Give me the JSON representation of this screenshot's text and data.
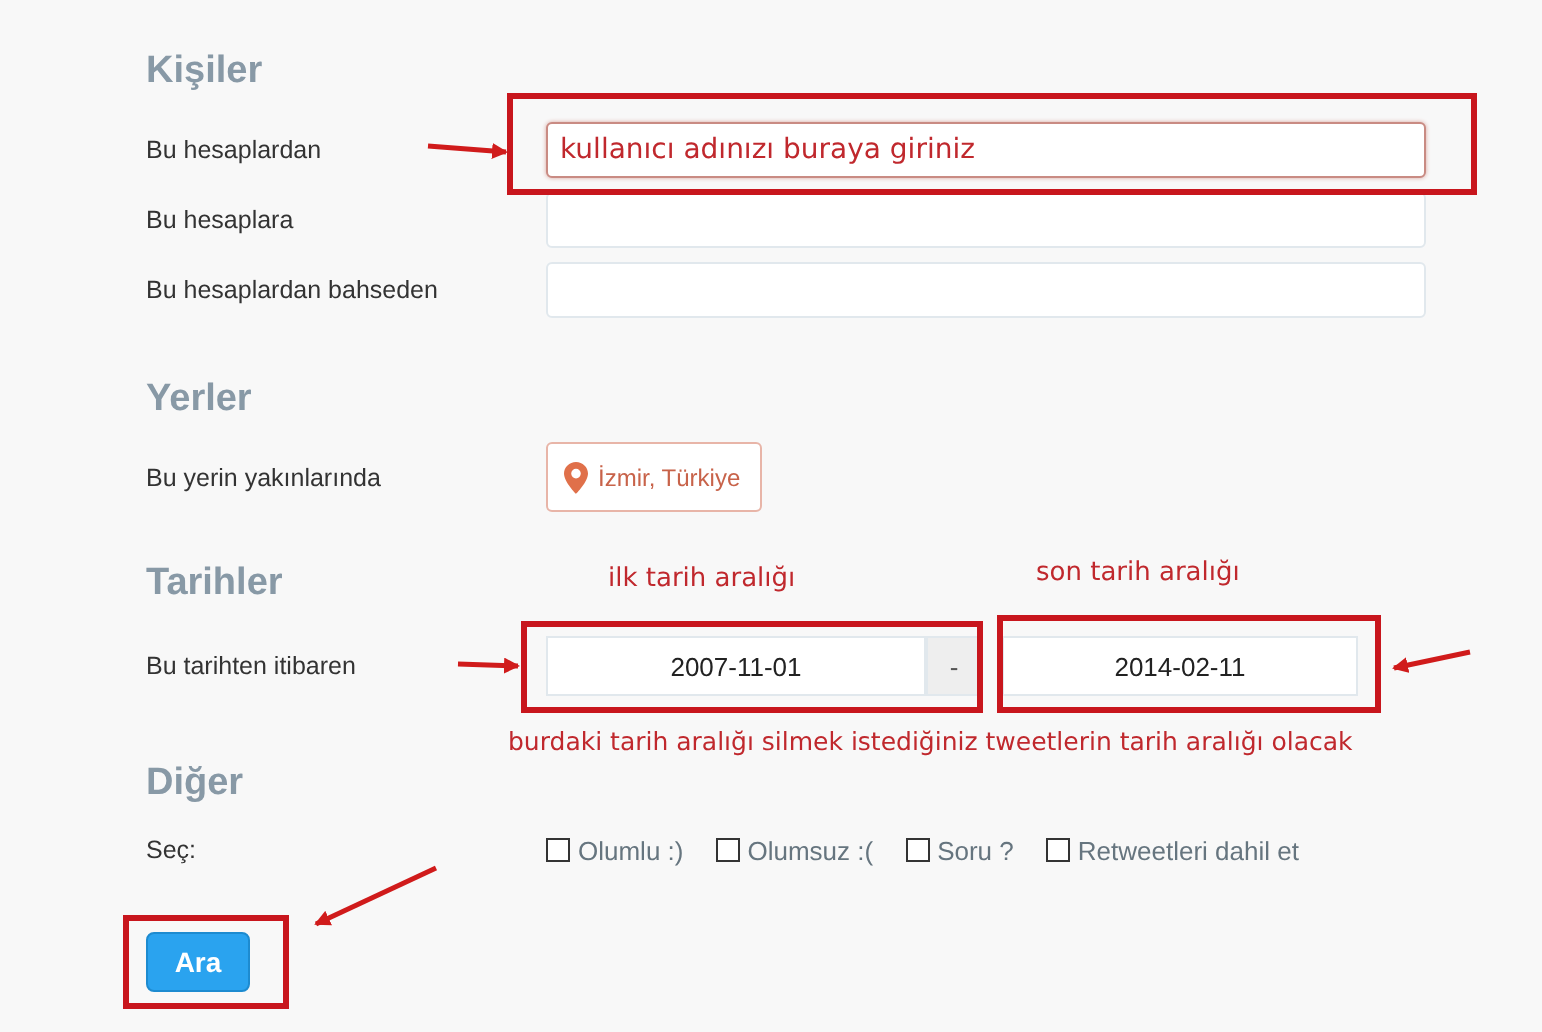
{
  "people": {
    "heading": "Kişiler",
    "rows": [
      {
        "label": "Bu hesaplardan",
        "value": "kullanıcı adınızı buraya giriniz",
        "focused": true
      },
      {
        "label": "Bu hesaplara",
        "value": "",
        "focused": false
      },
      {
        "label": "Bu hesaplardan bahseden",
        "value": "",
        "focused": false
      }
    ]
  },
  "places": {
    "heading": "Yerler",
    "label": "Bu yerin yakınlarında",
    "location": "İzmir, Türkiye"
  },
  "dates": {
    "heading": "Tarihler",
    "label": "Bu tarihten itibaren",
    "from": "2007-11-01",
    "separator": "-",
    "to": "2014-02-11"
  },
  "other": {
    "heading": "Diğer",
    "label": "Seç:",
    "options": [
      {
        "label": "Olumlu :)",
        "checked": false
      },
      {
        "label": "Olumsuz :(",
        "checked": false
      },
      {
        "label": "Soru ?",
        "checked": false
      },
      {
        "label": "Retweetleri dahil et",
        "checked": false
      }
    ]
  },
  "search_button": "Ara",
  "annotations": {
    "from_note": "ilk tarih aralığı",
    "to_note": "son tarih aralığı",
    "range_note": "burdaki tarih aralığı silmek istediğiniz tweetlerin tarih aralığı olacak"
  }
}
